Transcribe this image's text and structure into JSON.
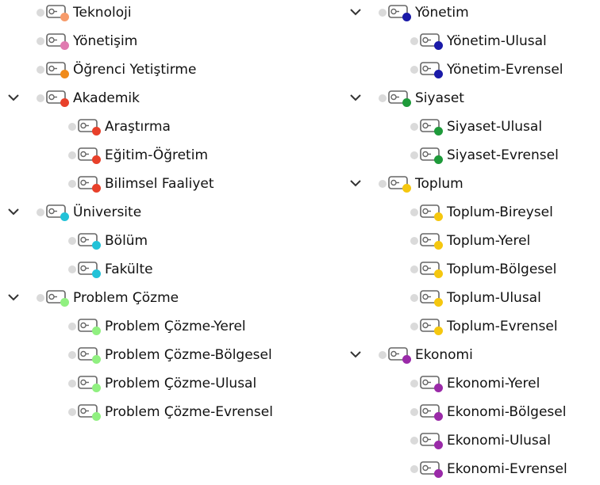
{
  "left_tree": [
    {
      "label": "Teknoloji",
      "color": "#f79b6b",
      "level": 0,
      "expandable": false
    },
    {
      "label": "Yönetişim",
      "color": "#e07ab0",
      "level": 0,
      "expandable": false
    },
    {
      "label": "Öğrenci Yetiştirme",
      "color": "#f08a1a",
      "level": 0,
      "expandable": false
    },
    {
      "label": "Akademik",
      "color": "#e8402a",
      "level": 0,
      "expandable": true
    },
    {
      "label": "Araştırma",
      "color": "#e8402a",
      "level": 1,
      "expandable": false
    },
    {
      "label": "Eğitim-Öğretim",
      "color": "#e8402a",
      "level": 1,
      "expandable": false
    },
    {
      "label": "Bilimsel Faaliyet",
      "color": "#e8402a",
      "level": 1,
      "expandable": false
    },
    {
      "label": "Üniversite",
      "color": "#22c2d8",
      "level": 0,
      "expandable": true
    },
    {
      "label": "Bölüm",
      "color": "#22c2d8",
      "level": 1,
      "expandable": false
    },
    {
      "label": "Fakülte",
      "color": "#22c2d8",
      "level": 1,
      "expandable": false
    },
    {
      "label": "Problem Çözme",
      "color": "#90f080",
      "level": 0,
      "expandable": true
    },
    {
      "label": "Problem Çözme-Yerel",
      "color": "#90f080",
      "level": 1,
      "expandable": false
    },
    {
      "label": "Problem Çözme-Bölgesel",
      "color": "#90f080",
      "level": 1,
      "expandable": false
    },
    {
      "label": "Problem Çözme-Ulusal",
      "color": "#90f080",
      "level": 1,
      "expandable": false
    },
    {
      "label": "Problem Çözme-Evrensel",
      "color": "#90f080",
      "level": 1,
      "expandable": false
    }
  ],
  "right_tree": [
    {
      "label": "Yönetim",
      "color": "#1a1aa8",
      "level": 0,
      "expandable": true
    },
    {
      "label": "Yönetim-Ulusal",
      "color": "#1a1aa8",
      "level": 1,
      "expandable": false
    },
    {
      "label": "Yönetim-Evrensel",
      "color": "#1a1aa8",
      "level": 1,
      "expandable": false
    },
    {
      "label": "Siyaset",
      "color": "#1e9a3a",
      "level": 0,
      "expandable": true
    },
    {
      "label": "Siyaset-Ulusal",
      "color": "#1e9a3a",
      "level": 1,
      "expandable": false
    },
    {
      "label": "Siyaset-Evrensel",
      "color": "#1e9a3a",
      "level": 1,
      "expandable": false
    },
    {
      "label": "Toplum",
      "color": "#f5c70f",
      "level": 0,
      "expandable": true
    },
    {
      "label": "Toplum-Bireysel",
      "color": "#f5c70f",
      "level": 1,
      "expandable": false
    },
    {
      "label": "Toplum-Yerel",
      "color": "#f5c70f",
      "level": 1,
      "expandable": false
    },
    {
      "label": "Toplum-Bölgesel",
      "color": "#f5c70f",
      "level": 1,
      "expandable": false
    },
    {
      "label": "Toplum-Ulusal",
      "color": "#f5c70f",
      "level": 1,
      "expandable": false
    },
    {
      "label": "Toplum-Evrensel",
      "color": "#f5c70f",
      "level": 1,
      "expandable": false
    },
    {
      "label": "Ekonomi",
      "color": "#9a2aa8",
      "level": 0,
      "expandable": true
    },
    {
      "label": "Ekonomi-Yerel",
      "color": "#9a2aa8",
      "level": 1,
      "expandable": false
    },
    {
      "label": "Ekonomi-Bölgesel",
      "color": "#9a2aa8",
      "level": 1,
      "expandable": false
    },
    {
      "label": "Ekonomi-Ulusal",
      "color": "#9a2aa8",
      "level": 1,
      "expandable": false
    },
    {
      "label": "Ekonomi-Evrensel",
      "color": "#9a2aa8",
      "level": 1,
      "expandable": false
    }
  ],
  "icons": {
    "chevron": "chevron-down-icon",
    "status": "status-circle-icon",
    "tag": "tag-icon",
    "color_dot": "color-dot-icon"
  }
}
